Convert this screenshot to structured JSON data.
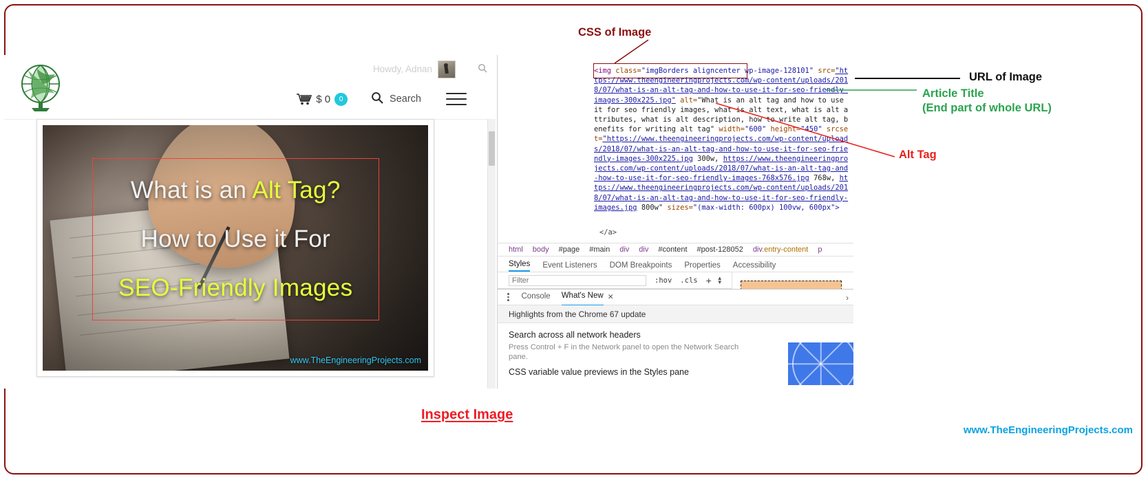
{
  "caption": "Inspect Image",
  "site_footer": "www.TheEngineeringProjects.com",
  "annotations": {
    "css_of_image": "CSS of Image",
    "url_of_image": "URL of Image",
    "article_title": "Article Title",
    "article_title_sub": "(End part of whole URL)",
    "alt_tag": "Alt Tag"
  },
  "site": {
    "howdy": "Howdy, Adnan",
    "cart_price": "$ 0",
    "cart_count": "0",
    "search_label": "Search",
    "featured_image": {
      "line1_a": "What is an ",
      "line1_b": "Alt Tag?",
      "line2": "How to Use it For",
      "line3": "SEO-Friendly Images",
      "credit": "www.TheEngineeringProjects.com"
    }
  },
  "devtools": {
    "code_segments": [
      {
        "t": "<img ",
        "k": "tag"
      },
      {
        "t": "class=",
        "k": "attr"
      },
      {
        "t": "\"imgBorders aligncenter wp-image-128101\"",
        "k": "val"
      },
      {
        "t": " src=",
        "k": "attr"
      },
      {
        "t": "\"https://www.theengineeringprojects.com/wp-content/uploads/2018/07/what-is-an-alt-tag-and-how-to-use-it-for-seo-friendly-images-300x225.jpg\"",
        "k": "url"
      },
      {
        "t": " alt=",
        "k": "attr"
      },
      {
        "t": "\"What is an alt tag and how to use it for seo friendly images, what is alt text, what is alt attributes, what is alt description, how to write alt tag, benefits for writing alt tag\"",
        "k": "plain"
      },
      {
        "t": " width=",
        "k": "attr"
      },
      {
        "t": "\"600\"",
        "k": "val"
      },
      {
        "t": " height=",
        "k": "attr"
      },
      {
        "t": "\"450\"",
        "k": "val"
      },
      {
        "t": " srcset=",
        "k": "attr"
      },
      {
        "t": "\"https://www.theengineeringprojects.com/wp-content/uploads/2018/07/what-is-an-alt-tag-and-how-to-use-it-for-seo-friendly-images-300x225.jpg",
        "k": "url"
      },
      {
        "t": " 300w, ",
        "k": "plain"
      },
      {
        "t": "https://www.theengineeringprojects.com/wp-content/uploads/2018/07/what-is-an-alt-tag-and-how-to-use-it-for-seo-friendly-images-768x576.jpg",
        "k": "url"
      },
      {
        "t": " 768w, ",
        "k": "plain"
      },
      {
        "t": "https://www.theengineeringprojects.com/wp-content/uploads/2018/07/what-is-an-alt-tag-and-how-to-use-it-for-seo-friendly-images.jpg",
        "k": "url"
      },
      {
        "t": " 800w\"",
        "k": "plain"
      },
      {
        "t": " sizes=",
        "k": "attr"
      },
      {
        "t": "\"(max-width: 600px) 100vw, 600px\">",
        "k": "val"
      }
    ],
    "code_closing": "</a>",
    "breadcrumb": [
      {
        "label": "html",
        "type": "tag"
      },
      {
        "label": "body",
        "type": "tag"
      },
      {
        "label": "#page",
        "type": "id"
      },
      {
        "label": "#main",
        "type": "id"
      },
      {
        "label": "div",
        "type": "tag"
      },
      {
        "label": "div",
        "type": "tag"
      },
      {
        "label": "#content",
        "type": "id"
      },
      {
        "label": "#post-128052",
        "type": "id"
      },
      {
        "label": "div.entry-content",
        "type": "tagcls"
      },
      {
        "label": "p",
        "type": "tag"
      }
    ],
    "styles_tabs": [
      "Styles",
      "Event Listeners",
      "DOM Breakpoints",
      "Properties",
      "Accessibility"
    ],
    "styles_active": "Styles",
    "filter_placeholder": "Filter",
    "filter_value": "",
    "hov_token": ":hov",
    "cls_token": ".cls",
    "drawer_tabs": [
      "Console",
      "What's New"
    ],
    "drawer_active": "What's New",
    "whats_new_header": "Highlights from the Chrome 67 update",
    "whats_new_items": [
      {
        "title": "Search across all network headers",
        "desc": "Press Control + F in the Network panel to open the Network Search pane."
      },
      {
        "title": "CSS variable value previews in the Styles pane",
        "desc": ""
      }
    ]
  },
  "colors": {
    "frame_border": "#8c1010",
    "annotation_red": "#e8221b",
    "annotation_green": "#2aa44f",
    "annotation_dark_red": "#8c1010",
    "caption_red": "#ee1c25",
    "footer_blue": "#0aa3e0",
    "devtools_accent": "#1a9bf0",
    "cart_badge": "#22c8dd",
    "headline_yellow": "#e5ff3a",
    "redbox_border": "#e8453c"
  }
}
